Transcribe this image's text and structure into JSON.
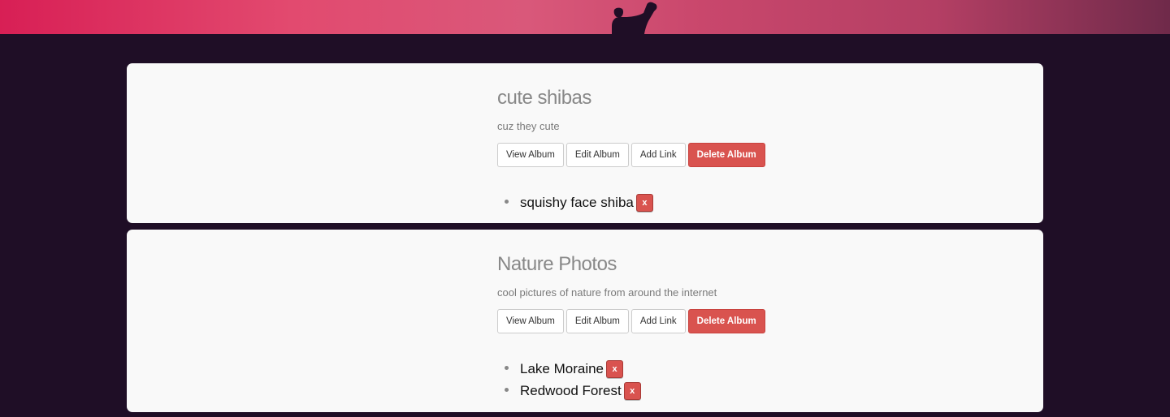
{
  "colors": {
    "page_background": "#1f0e26",
    "card_background": "#f9f9f9",
    "danger": "#d9534f",
    "title_gray": "#888888"
  },
  "buttons": {
    "view": "View Album",
    "edit": "Edit Album",
    "add_link": "Add Link",
    "delete": "Delete Album",
    "remove_link": "x"
  },
  "albums": [
    {
      "title": "cute shibas",
      "description": "cuz they cute",
      "links": [
        "squishy face shiba"
      ]
    },
    {
      "title": "Nature Photos",
      "description": "cool pictures of nature from around the internet",
      "links": [
        "Lake Moraine",
        "Redwood Forest"
      ]
    }
  ]
}
